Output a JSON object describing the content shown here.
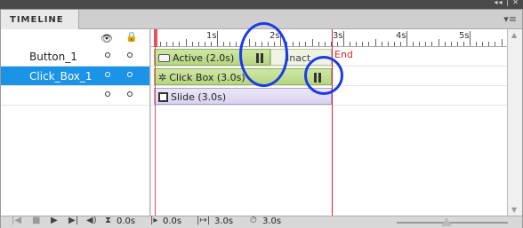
{
  "window": {
    "controls": "◂◂ | ✕"
  },
  "panel": {
    "tab": "TIMELINE",
    "menu_icon": "menu-icon"
  },
  "layers": {
    "header_icons": [
      "eye-icon",
      "lock-icon"
    ],
    "rows": [
      {
        "name": "Button_1",
        "selected": false
      },
      {
        "name": "Click_Box_1",
        "selected": true
      },
      {
        "name": "",
        "selected": false
      }
    ]
  },
  "ruler": {
    "labels": [
      "1s",
      "2s",
      "3s",
      "4s",
      "5s"
    ]
  },
  "markers": {
    "end_label": "End"
  },
  "tracks": {
    "active": "Active (2.0s)",
    "inactive": "Inact",
    "clickbox": "Click Box (3.0s)",
    "slide": "Slide (3.0s)"
  },
  "footer": {
    "t1": "0.0s",
    "t2": "0.0s",
    "t3": "3.0s",
    "t4": "3.0s",
    "zoom_slider": 0.45
  },
  "colors": {
    "selection": "#1b93e6",
    "playhead": "#e8505b",
    "end_marker": "#d9242b",
    "highlight_circle": "#1a3be8"
  }
}
